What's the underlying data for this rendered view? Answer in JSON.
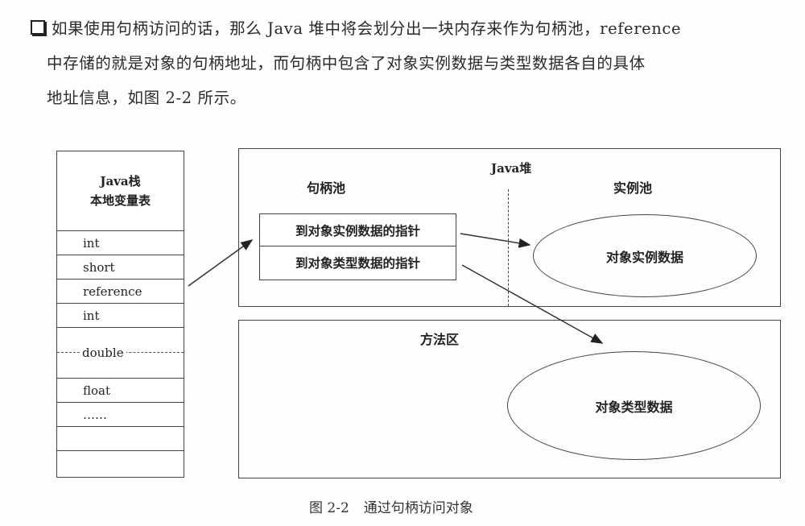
{
  "paragraph": {
    "bullet_icon": "checkbox-square-icon",
    "lines": [
      "如果使用句柄访问的话，那么 Java 堆中将会划分出一块内存来作为句柄池，reference",
      "中存储的就是对象的句柄地址，而句柄中包含了对象实例数据与类型数据各自的具体",
      "地址信息，如图 2-2 所示。"
    ]
  },
  "diagram": {
    "stack": {
      "title_line1": "Java栈",
      "title_line2": "本地变量表",
      "slots": [
        "int",
        "short",
        "reference",
        "int",
        "double",
        "float",
        "……",
        "",
        ""
      ]
    },
    "heap": {
      "title": "Java堆",
      "handle_pool_label": "句柄池",
      "instance_pool_label": "实例池",
      "handle_rows": [
        "到对象实例数据的指针",
        "到对象类型数据的指针"
      ],
      "instance_data": "对象实例数据"
    },
    "method_area": {
      "title": "方法区",
      "type_data": "对象类型数据"
    }
  },
  "caption": {
    "number": "图 2-2",
    "text": "通过句柄访问对象"
  }
}
